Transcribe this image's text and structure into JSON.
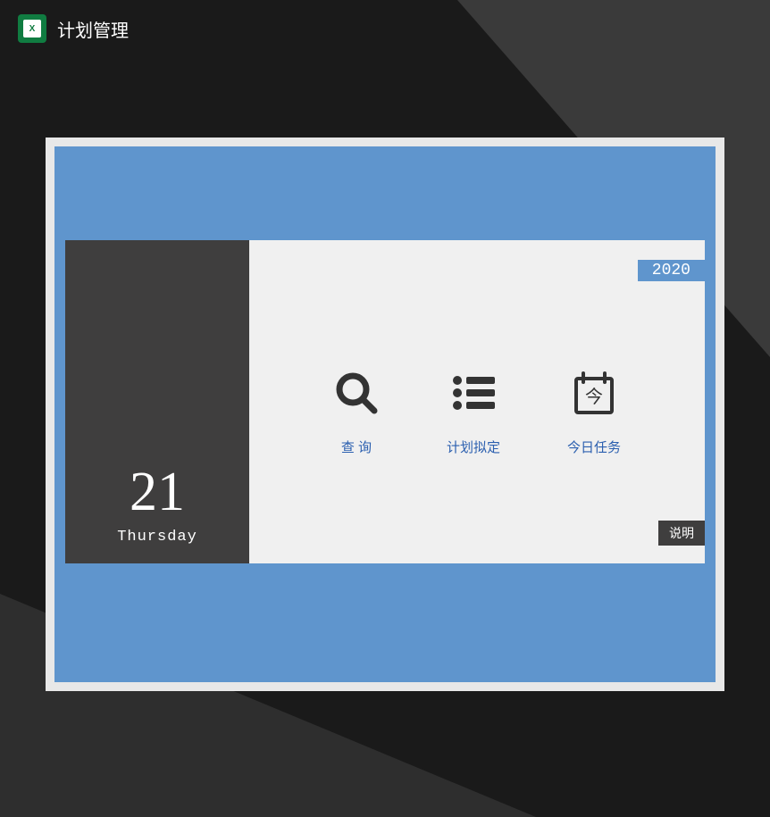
{
  "header": {
    "title": "计划管理",
    "icon_label": "X"
  },
  "date_panel": {
    "day_number": "21",
    "day_name": "Thursday"
  },
  "year_badge": "2020",
  "actions": {
    "search": {
      "label": "查  询"
    },
    "plan": {
      "label": "计划拟定"
    },
    "today": {
      "label": "今日任务",
      "icon_char": "今"
    }
  },
  "info_button": "说明"
}
